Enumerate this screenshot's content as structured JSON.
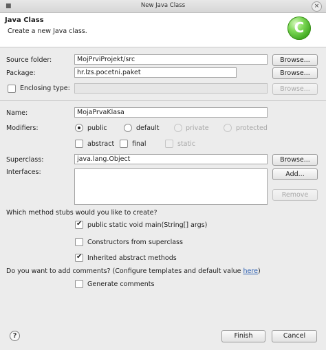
{
  "window": {
    "title": "New Java Class",
    "close_glyph": "×"
  },
  "header": {
    "title": "Java Class",
    "description": "Create a new Java class.",
    "logo_letter": "C"
  },
  "form": {
    "source_folder": {
      "label": "Source folder:",
      "value": "MojPrviProjekt/src",
      "button": "Browse..."
    },
    "package": {
      "label": "Package:",
      "value": "hr.lzs.pocetni.paket",
      "button": "Browse..."
    },
    "enclosing_type": {
      "label": "Enclosing type:",
      "value": "",
      "button": "Browse...",
      "checked": false
    },
    "name": {
      "label": "Name:",
      "value": "MojaPrvaKlasa"
    },
    "modifiers": {
      "label": "Modifiers:",
      "radios": [
        "public",
        "default",
        "private",
        "protected"
      ],
      "selected": "public",
      "checks": [
        "abstract",
        "final",
        "static"
      ]
    },
    "superclass": {
      "label": "Superclass:",
      "value": "java.lang.Object",
      "button": "Browse..."
    },
    "interfaces": {
      "label": "Interfaces:",
      "add_button": "Add...",
      "remove_button": "Remove"
    },
    "stubs": {
      "question": "Which method stubs would you like to create?",
      "options": [
        {
          "label": "public static void main(String[] args)",
          "checked": true
        },
        {
          "label": "Constructors from superclass",
          "checked": false
        },
        {
          "label": "Inherited abstract methods",
          "checked": true
        }
      ]
    },
    "comments": {
      "question": "Do you want to add comments? (Configure templates and default value ",
      "link": "here",
      "close": ")",
      "option": "Generate comments",
      "checked": false
    }
  },
  "footer": {
    "help_glyph": "?",
    "finish": "Finish",
    "cancel": "Cancel"
  },
  "icons": [
    "close-icon",
    "java-class-logo-icon",
    "help-icon",
    "check-icon"
  ]
}
